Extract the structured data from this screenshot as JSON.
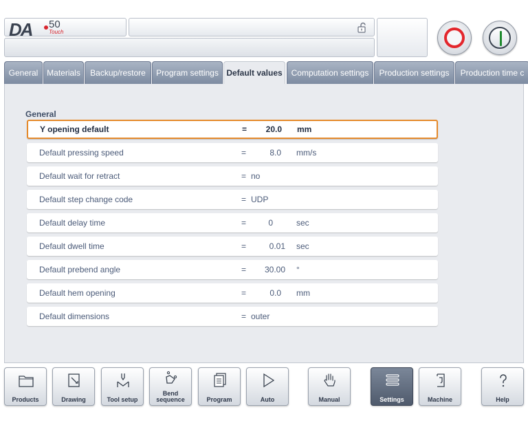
{
  "header": {
    "logo_text": "DA",
    "logo_number": "50",
    "logo_sub": "Touch",
    "message": "",
    "status": ""
  },
  "tabs": [
    {
      "label": "General"
    },
    {
      "label": "Materials"
    },
    {
      "label": "Backup/restore"
    },
    {
      "label": "Program settings"
    },
    {
      "label": "Default values"
    },
    {
      "label": "Computation settings"
    },
    {
      "label": "Production settings"
    },
    {
      "label": "Production time c"
    }
  ],
  "active_tab": "Default values",
  "section": {
    "title": "General"
  },
  "rows": [
    {
      "label": "Y opening default",
      "eq": "=",
      "value": "20.0",
      "unit": "mm"
    },
    {
      "label": "Default pressing speed",
      "eq": "=",
      "value": "8.0",
      "unit": "mm/s"
    },
    {
      "label": "Default wait for retract",
      "eq": "=",
      "value": "no",
      "unit": ""
    },
    {
      "label": "Default step change code",
      "eq": "=",
      "value": "UDP",
      "unit": ""
    },
    {
      "label": "Default delay time",
      "eq": "=",
      "value": "0",
      "unit": "sec"
    },
    {
      "label": "Default dwell time",
      "eq": "=",
      "value": "0.01",
      "unit": "sec"
    },
    {
      "label": "Default prebend angle",
      "eq": "=",
      "value": "30.00",
      "unit": "°"
    },
    {
      "label": "Default hem opening",
      "eq": "=",
      "value": "0.0",
      "unit": "mm"
    },
    {
      "label": "Default dimensions",
      "eq": "=",
      "value": "outer",
      "unit": ""
    }
  ],
  "nav": {
    "products": "Products",
    "drawing": "Drawing",
    "tool_setup": "Tool setup",
    "bend_sequence_1": "Bend",
    "bend_sequence_2": "sequence",
    "program": "Program",
    "auto": "Auto",
    "manual": "Manual",
    "settings": "Settings",
    "machine": "Machine",
    "help": "Help"
  },
  "colors": {
    "accent_orange": "#e5892a",
    "stop_red": "#e3262c",
    "start_green": "#1f8a2e",
    "tab_blue": "#8d9ab0"
  }
}
